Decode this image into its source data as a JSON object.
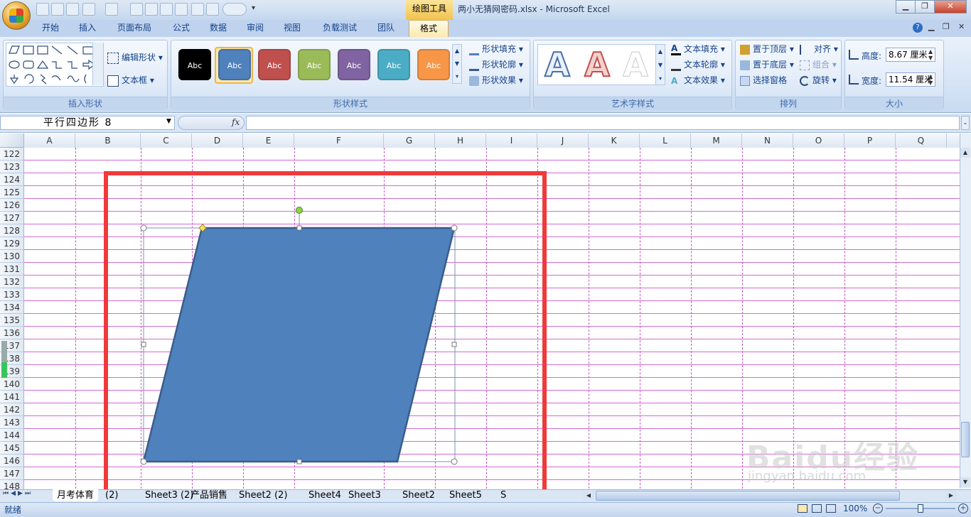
{
  "qat_icons": [
    "save-icon",
    "open-icon",
    "print-preview-icon",
    "undo-icon",
    "draw-icon",
    "function-icon",
    "table-icon",
    "form-icon",
    "chart-icon",
    "filter-icon",
    "spelling-icon",
    "camera-icon"
  ],
  "context_tab": "绘图工具",
  "window_title": "两小无猜网密码.xlsx - Microsoft Excel",
  "tabs": [
    "开始",
    "插入",
    "页面布局",
    "公式",
    "数据",
    "审阅",
    "视图",
    "负载测试",
    "团队",
    "格式"
  ],
  "active_tab": "格式",
  "ribbon": {
    "insert_shapes": {
      "edit_shape": "编辑形状",
      "text_box": "文本框",
      "label": "插入形状"
    },
    "shape_styles": {
      "sample_text": "Abc",
      "fill": "形状填充",
      "outline": "形状轮廓",
      "effects": "形状效果",
      "label": "形状样式",
      "colors": [
        "#000000",
        "#4f81bd",
        "#c0504d",
        "#9bbb59",
        "#8064a2",
        "#4bacc6",
        "#f79646"
      ]
    },
    "wordart": {
      "glyph": "A",
      "fill": "文本填充",
      "outline": "文本轮廓",
      "effects": "文本效果",
      "label": "艺术字样式"
    },
    "arrange": {
      "bring_front": "置于顶层",
      "send_back": "置于底层",
      "selection_pane": "选择窗格",
      "align": "对齐",
      "group": "组合",
      "rotate": "旋转",
      "label": "排列"
    },
    "size": {
      "height_label": "高度:",
      "height_value": "8.67 厘米",
      "width_label": "宽度:",
      "width_value": "11.54 厘米",
      "label": "大小"
    }
  },
  "name_box": "平行四边形 8",
  "fx": "fx",
  "columns": [
    "A",
    "B",
    "C",
    "D",
    "E",
    "F",
    "G",
    "H",
    "I",
    "J",
    "K",
    "L",
    "M",
    "N",
    "O",
    "P",
    "Q"
  ],
  "rows": [
    "122",
    "123",
    "124",
    "125",
    "126",
    "127",
    "128",
    "129",
    "130",
    "131",
    "132",
    "133",
    "134",
    "135",
    "136",
    "137",
    "138",
    "139",
    "140",
    "141",
    "142",
    "143",
    "144",
    "145",
    "146",
    "147",
    "148"
  ],
  "shape": {
    "type": "parallelogram",
    "fill": "#4f81bd",
    "outline": "#385d8a"
  },
  "highlight_color": "#f03a3a",
  "sheet_tabs": [
    "月考体育",
    "(2)",
    "Sheet3 (2)",
    "产品销售",
    "Sheet2 (2)",
    "Sheet4",
    "Sheet3",
    "Sheet2",
    "Sheet5",
    "S"
  ],
  "status": {
    "mode": "就绪",
    "zoom": "100%"
  },
  "watermark": "Baidu经验",
  "watermark_url": "jingyan.baidu.com"
}
